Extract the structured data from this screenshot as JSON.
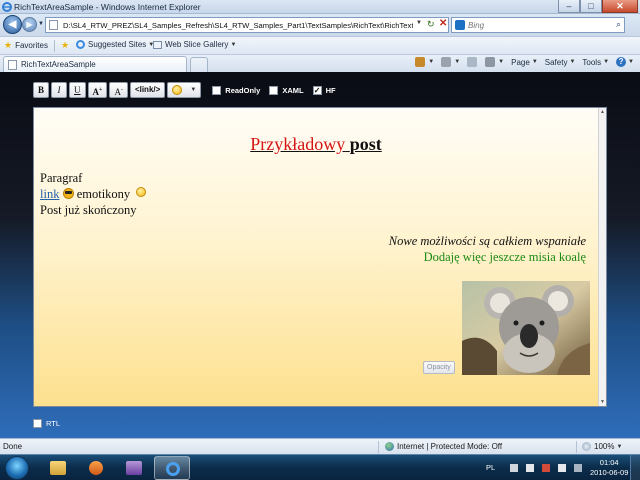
{
  "window": {
    "title": "RichTextAreaSample - Windows Internet Explorer",
    "minimize": "–",
    "maximize": "□",
    "close": "✕"
  },
  "address_bar": {
    "back": "◀",
    "forward": "▶",
    "url": "D:\\SL4_RTW_PREZ\\SL4_Samples_Refresh\\SL4_RTW_Samples_Part1\\TextSamples\\RichText\\RichTextArea",
    "refresh": "↻",
    "stop": "✕",
    "search_placeholder": "Bing",
    "search_go": "⌕"
  },
  "favorites_bar": {
    "favorites": "Favorites",
    "suggested_sites": "Suggested Sites",
    "web_slice_gallery": "Web Slice Gallery"
  },
  "tab_bar": {
    "tab_label": "RichTextAreaSample",
    "commands": [
      "Page",
      "Safety",
      "Tools"
    ],
    "help": "?"
  },
  "toolbar": {
    "bold": "B",
    "italic": "I",
    "underline": "U",
    "grow_font": "A",
    "grow_sup": "+",
    "shrink_font": "A",
    "shrink_sup": "-",
    "link": "<link/>",
    "readonly_label": "ReadOnly",
    "readonly_checked": "",
    "xaml_label": "XAML",
    "xaml_checked": "",
    "hf_label": "HF",
    "hf_checked": "✓"
  },
  "editor": {
    "headline_red": "Przykładowy",
    "headline_black": "post",
    "paragraph": "Paragraf",
    "link_text": "link",
    "emoticons_text": "emotikony",
    "post_done": "Post już skończony",
    "italic_line": "Nowe możliwości są całkiem wspaniałe",
    "green_line": "Dodaję więc jeszcze misia koalę",
    "opacity_button": "Opacity"
  },
  "footer": {
    "rtl_label": "RTL"
  },
  "status_bar": {
    "status": "Done",
    "zone": "Internet | Protected Mode: Off",
    "zoom": "100%"
  },
  "taskbar": {
    "language": "PL",
    "time": "01:04",
    "date": "2010-06-09"
  },
  "colors": {
    "headline_red": "#d51414",
    "green_text": "#1c8a14",
    "link_blue": "#2461a8"
  }
}
